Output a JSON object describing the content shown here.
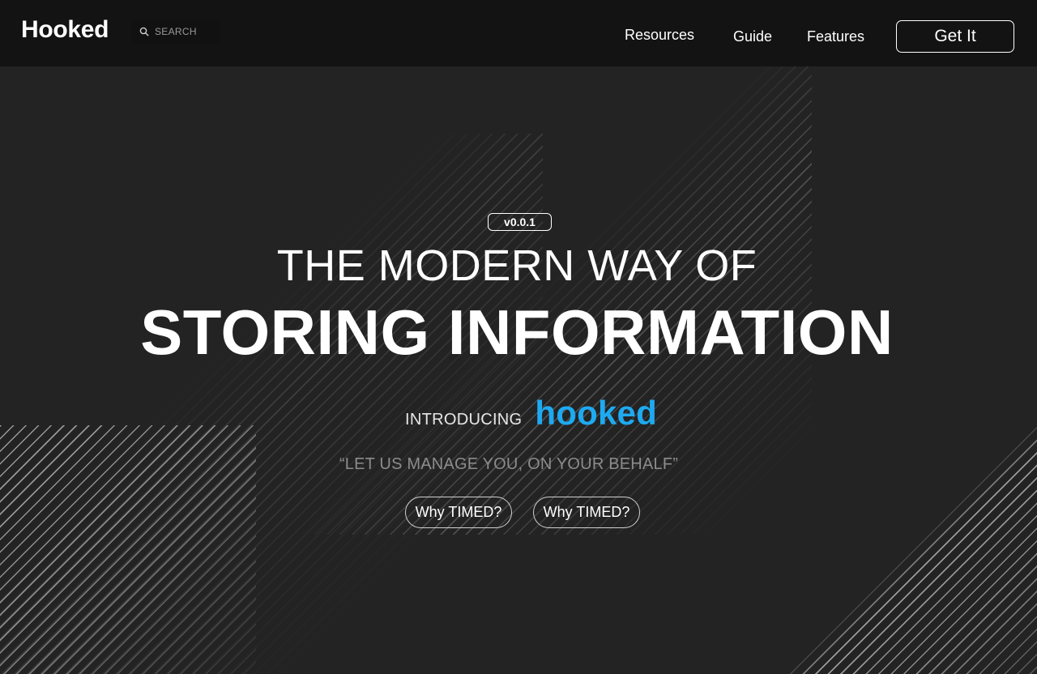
{
  "header": {
    "brand": "Hooked",
    "search": {
      "placeholder": "SEARCH",
      "icon": "search-icon"
    },
    "nav": {
      "resources": "Resources",
      "guide": "Guide",
      "features": "Features"
    },
    "cta_label": "Get It"
  },
  "hero": {
    "version": "v0.0.1",
    "headline_line1": "THE MODERN WAY OF",
    "headline_line2": "STORING INFORMATION",
    "intro_label": "INTRODUCING",
    "intro_brand": "hooked",
    "tagline": "“LET US MANAGE YOU, ON YOUR BEHALF”",
    "buttons": [
      "Why TIMED?",
      "Why TIMED?"
    ]
  },
  "colors": {
    "background": "#232323",
    "header_background": "#131313",
    "accent": "#1eaaf1",
    "tagline": "#8c8c8c"
  }
}
